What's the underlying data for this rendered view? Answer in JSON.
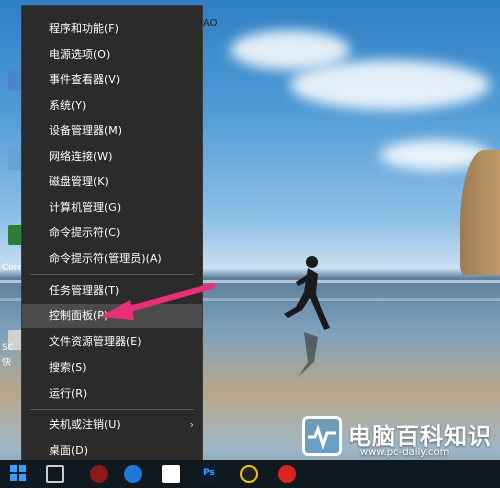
{
  "context_menu": {
    "items": [
      {
        "label": "程序和功能(F)"
      },
      {
        "label": "电源选项(O)"
      },
      {
        "label": "事件查看器(V)"
      },
      {
        "label": "系统(Y)"
      },
      {
        "label": "设备管理器(M)"
      },
      {
        "label": "网络连接(W)"
      },
      {
        "label": "磁盘管理(K)"
      },
      {
        "label": "计算机管理(G)"
      },
      {
        "label": "命令提示符(C)"
      },
      {
        "label": "命令提示符(管理员)(A)"
      },
      {
        "label": "任务管理器(T)"
      },
      {
        "label": "控制面板(P)",
        "highlighted": true
      },
      {
        "label": "文件资源管理器(E)"
      },
      {
        "label": "搜索(S)"
      },
      {
        "label": "运行(R)"
      },
      {
        "label": "关机或注销(U)",
        "has_submenu": true
      },
      {
        "label": "桌面(D)"
      }
    ],
    "submenu_glyph": "›"
  },
  "desktop": {
    "labels": [
      "Core",
      "SC",
      "快"
    ],
    "top_right_fragment": "AO"
  },
  "taskbar": {
    "ps_label": "Ps"
  },
  "watermark": {
    "title": "电脑百科知识",
    "url": "www.pc-daily.com"
  },
  "colors": {
    "menu_bg": "#2b2b2b",
    "menu_highlight": "#4b4b4b",
    "arrow": "#e8307a",
    "taskbar": "#101820"
  },
  "icons": [
    "windows-start-icon",
    "task-view-icon",
    "edge-browser-icon",
    "windows-store-icon",
    "photoshop-icon",
    "qq-icon",
    "arrow-annotation-icon"
  ]
}
